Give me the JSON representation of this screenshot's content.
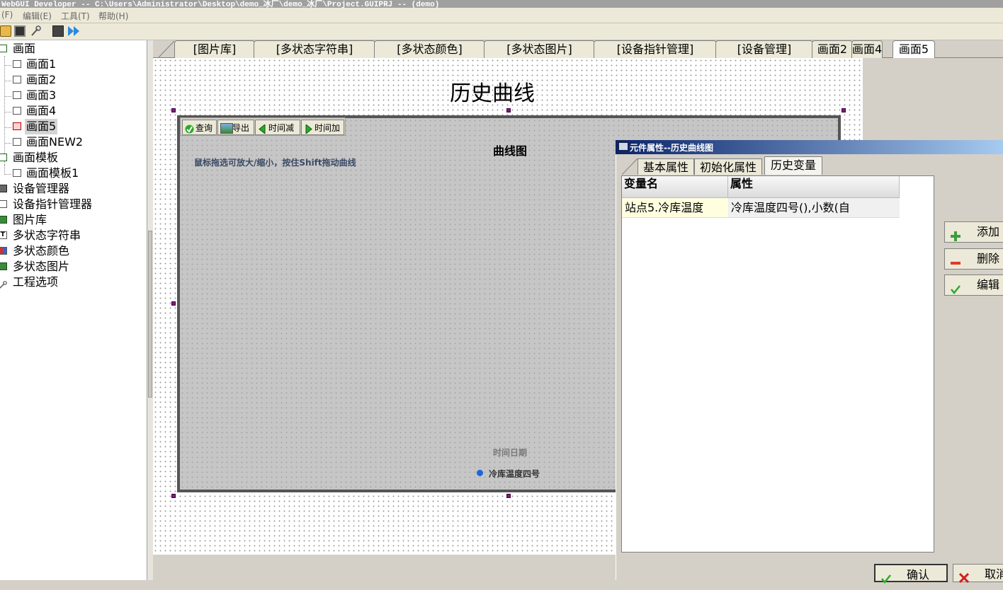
{
  "window": {
    "title": "WebGUI Developer -- C:\\Users\\Administrator\\Desktop\\demo_冰厂\\demo_冰厂\\Project.GUIPRJ -- (demo)"
  },
  "menu": [
    {
      "label": "(F)"
    },
    {
      "label": "编辑(E)"
    },
    {
      "label": "工具(T)"
    },
    {
      "label": "帮助(H)"
    }
  ],
  "toolbar": {
    "icons": [
      "open-folder-icon",
      "save-icon",
      "wrench-icon",
      "film-icon",
      "run-icon"
    ]
  },
  "tree": {
    "items": [
      {
        "label": "画面",
        "icon": "screen-folder-icon"
      },
      {
        "label": "画面1",
        "icon": "screen-icon"
      },
      {
        "label": "画面2",
        "icon": "screen-icon"
      },
      {
        "label": "画面3",
        "icon": "screen-icon"
      },
      {
        "label": "画面4",
        "icon": "screen-icon"
      },
      {
        "label": "画面5",
        "icon": "screen-icon",
        "selected": true
      },
      {
        "label": "画面NEW2",
        "icon": "screen-icon"
      },
      {
        "label": "画面模板",
        "icon": "screen-folder-icon"
      },
      {
        "label": "画面模板1",
        "icon": "screen-icon"
      },
      {
        "label": "设备管理器",
        "icon": "device-icon"
      },
      {
        "label": "设备指针管理器",
        "icon": "pointer-icon"
      },
      {
        "label": "图片库",
        "icon": "image-icon"
      },
      {
        "label": "多状态字符串",
        "icon": "text-icon"
      },
      {
        "label": "多状态颜色",
        "icon": "color-icon"
      },
      {
        "label": "多状态图片",
        "icon": "image-icon"
      },
      {
        "label": "工程选项",
        "icon": "wrench-icon"
      }
    ]
  },
  "editor_tabs": [
    {
      "label": "[图片库]"
    },
    {
      "label": "[多状态字符串]"
    },
    {
      "label": "[多状态颜色]"
    },
    {
      "label": "[多状态图片]"
    },
    {
      "label": "[设备指针管理]"
    },
    {
      "label": "[设备管理]"
    },
    {
      "label": "画面2"
    },
    {
      "label": "画面4"
    },
    {
      "label": "画面5",
      "active": true
    }
  ],
  "canvas": {
    "title": "历史曲线",
    "chart": {
      "buttons": [
        {
          "label": "查询"
        },
        {
          "label": "导出"
        },
        {
          "label": "时间减"
        },
        {
          "label": "时间加"
        }
      ],
      "title": "曲线图",
      "hint": "鼠标拖选可放大/缩小，按住Shift拖动曲线",
      "xlabel": "时间日期",
      "legend": "冷库温度四号",
      "legend_color": "#1a66e0"
    }
  },
  "dialog": {
    "title": "元件属性--历史曲线图",
    "tabs": [
      {
        "label": "基本属性"
      },
      {
        "label": "初始化属性"
      },
      {
        "label": "历史变量",
        "active": true
      }
    ],
    "grid": {
      "columns": [
        "变量名",
        "属性"
      ],
      "rows": [
        {
          "name": "站点5.冷库温度",
          "attr": "冷库温度四号(),小数(自"
        }
      ]
    },
    "side_buttons": [
      {
        "label": "添加",
        "icon": "plus-icon"
      },
      {
        "label": "删除",
        "icon": "minus-icon"
      },
      {
        "label": "编辑",
        "icon": "check-icon"
      }
    ],
    "ok_label": "确认",
    "cancel_label": "取消"
  }
}
